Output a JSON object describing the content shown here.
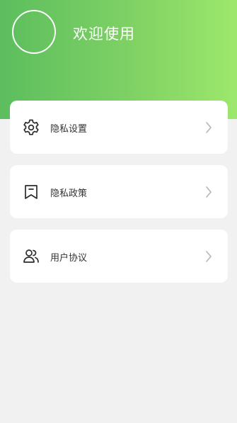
{
  "header": {
    "welcome_text": "欢迎使用"
  },
  "menu": {
    "items": [
      {
        "label": "隐私设置",
        "icon": "gear-icon"
      },
      {
        "label": "隐私政策",
        "icon": "bookmark-icon"
      },
      {
        "label": "用户协议",
        "icon": "users-icon"
      }
    ]
  },
  "colors": {
    "header_gradient_start": "#5cbe5e",
    "header_gradient_end": "#9de86c",
    "page_background": "#f1f1f1",
    "card_background": "#ffffff"
  }
}
